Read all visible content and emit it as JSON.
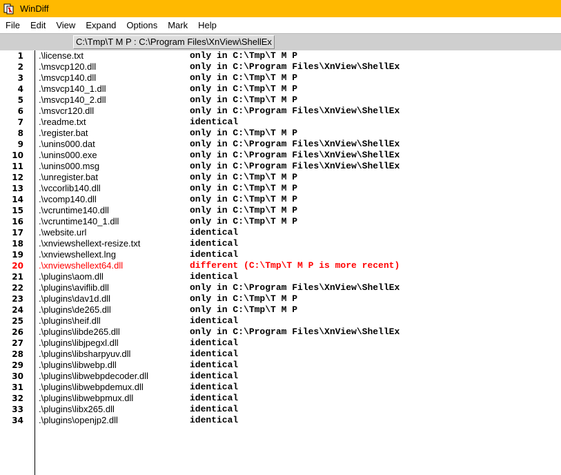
{
  "window": {
    "title": "WinDiff"
  },
  "menu": [
    "File",
    "Edit",
    "View",
    "Expand",
    "Options",
    "Mark",
    "Help"
  ],
  "status_path": "C:\\Tmp\\T M P : C:\\Program Files\\XnView\\ShellEx",
  "colors": {
    "titlebar": "#FFB900",
    "different": "#ff0000"
  },
  "rows": [
    {
      "n": "1",
      "name": ".\\license.txt",
      "status": "only in C:\\Tmp\\T M P"
    },
    {
      "n": "2",
      "name": ".\\msvcp120.dll",
      "status": "only in C:\\Program Files\\XnView\\ShellEx"
    },
    {
      "n": "3",
      "name": ".\\msvcp140.dll",
      "status": "only in C:\\Tmp\\T M P"
    },
    {
      "n": "4",
      "name": ".\\msvcp140_1.dll",
      "status": "only in C:\\Tmp\\T M P"
    },
    {
      "n": "5",
      "name": ".\\msvcp140_2.dll",
      "status": "only in C:\\Tmp\\T M P"
    },
    {
      "n": "6",
      "name": ".\\msvcr120.dll",
      "status": "only in C:\\Program Files\\XnView\\ShellEx"
    },
    {
      "n": "7",
      "name": ".\\readme.txt",
      "status": "identical"
    },
    {
      "n": "8",
      "name": ".\\register.bat",
      "status": "only in C:\\Tmp\\T M P"
    },
    {
      "n": "9",
      "name": ".\\unins000.dat",
      "status": "only in C:\\Program Files\\XnView\\ShellEx"
    },
    {
      "n": "10",
      "name": ".\\unins000.exe",
      "status": "only in C:\\Program Files\\XnView\\ShellEx"
    },
    {
      "n": "11",
      "name": ".\\unins000.msg",
      "status": "only in C:\\Program Files\\XnView\\ShellEx"
    },
    {
      "n": "12",
      "name": ".\\unregister.bat",
      "status": "only in C:\\Tmp\\T M P"
    },
    {
      "n": "13",
      "name": ".\\vccorlib140.dll",
      "status": "only in C:\\Tmp\\T M P"
    },
    {
      "n": "14",
      "name": ".\\vcomp140.dll",
      "status": "only in C:\\Tmp\\T M P"
    },
    {
      "n": "15",
      "name": ".\\vcruntime140.dll",
      "status": "only in C:\\Tmp\\T M P"
    },
    {
      "n": "16",
      "name": ".\\vcruntime140_1.dll",
      "status": "only in C:\\Tmp\\T M P"
    },
    {
      "n": "17",
      "name": ".\\website.url",
      "status": "identical"
    },
    {
      "n": "18",
      "name": ".\\xnviewshellext-resize.txt",
      "status": "identical"
    },
    {
      "n": "19",
      "name": ".\\xnviewshellext.lng",
      "status": "identical"
    },
    {
      "n": "20",
      "name": ".\\xnviewshellext64.dll",
      "status": "different (C:\\Tmp\\T M P is more recent)",
      "diff": true
    },
    {
      "n": "21",
      "name": ".\\plugins\\aom.dll",
      "status": "identical"
    },
    {
      "n": "22",
      "name": ".\\plugins\\aviflib.dll",
      "status": "only in C:\\Program Files\\XnView\\ShellEx"
    },
    {
      "n": "23",
      "name": ".\\plugins\\dav1d.dll",
      "status": "only in C:\\Tmp\\T M P"
    },
    {
      "n": "24",
      "name": ".\\plugins\\de265.dll",
      "status": "only in C:\\Tmp\\T M P"
    },
    {
      "n": "25",
      "name": ".\\plugins\\heif.dll",
      "status": "identical"
    },
    {
      "n": "26",
      "name": ".\\plugins\\libde265.dll",
      "status": "only in C:\\Program Files\\XnView\\ShellEx"
    },
    {
      "n": "27",
      "name": ".\\plugins\\libjpegxl.dll",
      "status": "identical"
    },
    {
      "n": "28",
      "name": ".\\plugins\\libsharpyuv.dll",
      "status": "identical"
    },
    {
      "n": "29",
      "name": ".\\plugins\\libwebp.dll",
      "status": "identical"
    },
    {
      "n": "30",
      "name": ".\\plugins\\libwebpdecoder.dll",
      "status": "identical"
    },
    {
      "n": "31",
      "name": ".\\plugins\\libwebpdemux.dll",
      "status": "identical"
    },
    {
      "n": "32",
      "name": ".\\plugins\\libwebpmux.dll",
      "status": "identical"
    },
    {
      "n": "33",
      "name": ".\\plugins\\libx265.dll",
      "status": "identical"
    },
    {
      "n": "34",
      "name": ".\\plugins\\openjp2.dll",
      "status": "identical"
    }
  ]
}
